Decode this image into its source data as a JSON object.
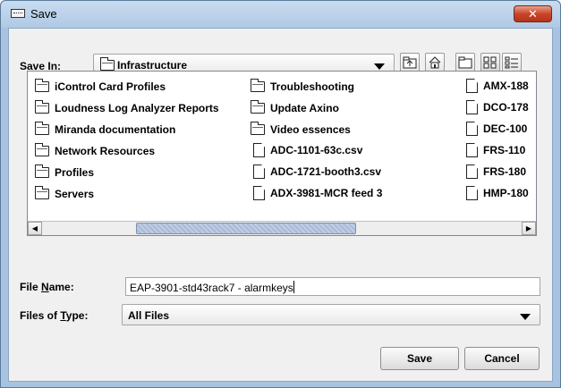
{
  "window": {
    "title": "Save",
    "close_glyph": "✕"
  },
  "save_in": {
    "label_pre": "Save ",
    "label_mnemonic": "I",
    "label_post": "n:",
    "value": "Infrastructure"
  },
  "toolbar": {
    "icons": [
      "up-folder-icon",
      "home-icon",
      "new-folder-icon",
      "list-view-icon",
      "details-view-icon"
    ]
  },
  "files": {
    "columns": [
      [
        {
          "type": "folder",
          "name": "iControl Card Profiles"
        },
        {
          "type": "folder",
          "name": "Loudness Log Analyzer Reports"
        },
        {
          "type": "folder",
          "name": "Miranda documentation"
        },
        {
          "type": "folder",
          "name": "Network Resources"
        },
        {
          "type": "folder",
          "name": "Profiles"
        },
        {
          "type": "folder",
          "name": "Servers"
        }
      ],
      [
        {
          "type": "folder",
          "name": "Troubleshooting"
        },
        {
          "type": "folder",
          "name": "Update Axino"
        },
        {
          "type": "folder",
          "name": "Video essences"
        },
        {
          "type": "file",
          "name": "ADC-1101-63c.csv"
        },
        {
          "type": "file",
          "name": "ADC-1721-booth3.csv"
        },
        {
          "type": "file",
          "name": "ADX-3981-MCR feed 3"
        }
      ],
      [
        {
          "type": "file",
          "name": "AMX-188"
        },
        {
          "type": "file",
          "name": "DCO-178"
        },
        {
          "type": "file",
          "name": "DEC-100"
        },
        {
          "type": "file",
          "name": "FRS-110"
        },
        {
          "type": "file",
          "name": "FRS-180"
        },
        {
          "type": "file",
          "name": "HMP-180"
        }
      ]
    ]
  },
  "file_name": {
    "label_pre": "File ",
    "label_mnemonic": "N",
    "label_post": "ame:",
    "value": "EAP-3901-std43rack7 - alarmkeys"
  },
  "files_of_type": {
    "label_pre": "Files of ",
    "label_mnemonic": "T",
    "label_post": "ype:",
    "value": "All Files"
  },
  "buttons": {
    "save": "Save",
    "cancel": "Cancel"
  }
}
